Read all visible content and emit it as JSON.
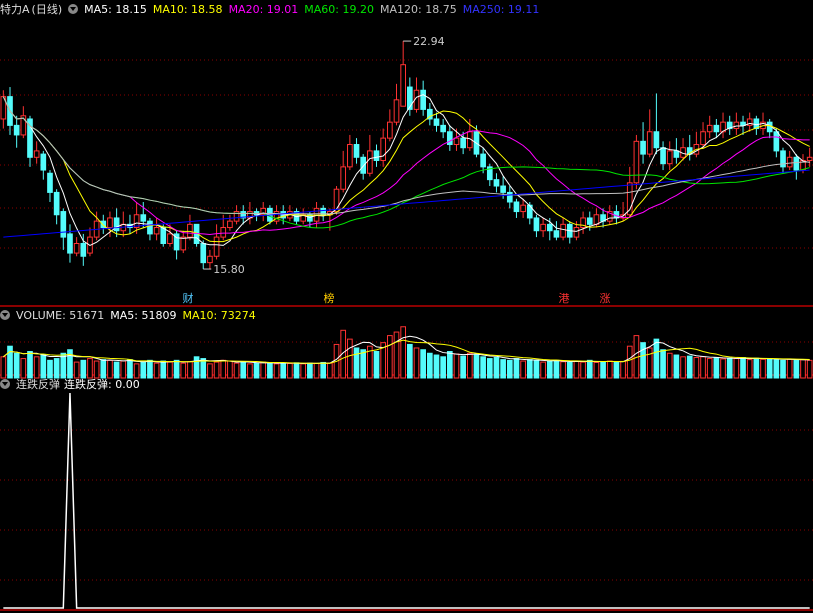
{
  "colors": {
    "up": "#ff3232",
    "down": "#54fcfc",
    "ma5": "#ffffff",
    "ma10": "#ffff00",
    "ma20": "#ff00ff",
    "ma60": "#00e600",
    "ma120": "#c0c0c0",
    "ma250": "#0000ff",
    "grid": "#8b0000"
  },
  "price_panel": {
    "stock_name": "特力A",
    "period": "(日线)",
    "ma_labels": [
      {
        "key": "ma5",
        "text": "MA5: 18.15"
      },
      {
        "key": "ma10",
        "text": "MA10: 18.58"
      },
      {
        "key": "ma20",
        "text": "MA20: 19.01"
      },
      {
        "key": "ma60",
        "text": "MA60: 19.20"
      },
      {
        "key": "ma120",
        "text": "MA120: 18.75"
      },
      {
        "key": "ma250",
        "text": "MA250: 19.11"
      }
    ],
    "high_label": "22.94",
    "low_label": "15.80",
    "event_tags": [
      {
        "text": "财",
        "index": 29
      },
      {
        "text": "榜",
        "index": 51
      },
      {
        "text": "港",
        "index": 89
      },
      {
        "text": "涨",
        "index": 96
      }
    ]
  },
  "volume_panel": {
    "title": "VOLUME: 51671",
    "ma5_label": "MA5: 51809",
    "ma10_label": "MA10: 73274"
  },
  "indicator_panel": {
    "title": "连跌反弹",
    "value_label": "连跌反弹: 0.00"
  },
  "chart_data": {
    "type": "candlestick",
    "ylim": [
      15.3,
      23.6
    ],
    "candles": [
      [
        20.5,
        21.2,
        20.2,
        21.4
      ],
      [
        21.2,
        20.3,
        20.0,
        21.5
      ],
      [
        20.3,
        20.0,
        19.6,
        20.6
      ],
      [
        20.0,
        20.6,
        19.9,
        20.9
      ],
      [
        20.5,
        19.3,
        19.0,
        20.6
      ],
      [
        19.3,
        19.5,
        19.1,
        19.8
      ],
      [
        19.4,
        18.9,
        18.6,
        19.5
      ],
      [
        18.8,
        18.2,
        17.9,
        18.9
      ],
      [
        18.2,
        17.5,
        17.2,
        18.3
      ],
      [
        17.6,
        16.8,
        16.4,
        17.7
      ],
      [
        16.9,
        16.3,
        16.0,
        17.2
      ],
      [
        16.3,
        16.6,
        16.2,
        16.8
      ],
      [
        16.6,
        16.2,
        15.9,
        16.9
      ],
      [
        16.3,
        16.8,
        16.2,
        17.1
      ],
      [
        16.8,
        17.3,
        16.7,
        17.6
      ],
      [
        17.3,
        17.1,
        16.9,
        17.5
      ],
      [
        17.1,
        17.4,
        16.8,
        17.6
      ],
      [
        17.4,
        17.0,
        16.8,
        17.7
      ],
      [
        17.0,
        17.2,
        16.8,
        17.6
      ],
      [
        17.2,
        17.1,
        16.9,
        17.5
      ],
      [
        17.1,
        17.5,
        16.9,
        17.9
      ],
      [
        17.5,
        17.3,
        17.1,
        17.9
      ],
      [
        17.3,
        16.9,
        16.7,
        17.4
      ],
      [
        16.9,
        17.1,
        16.7,
        17.4
      ],
      [
        17.1,
        16.6,
        16.5,
        17.2
      ],
      [
        16.6,
        16.9,
        16.5,
        17.2
      ],
      [
        16.9,
        16.4,
        16.1,
        17.0
      ],
      [
        16.4,
        16.8,
        16.3,
        17.0
      ],
      [
        16.8,
        17.2,
        16.7,
        17.5
      ],
      [
        17.2,
        16.6,
        16.5,
        17.2
      ],
      [
        16.6,
        16.0,
        15.8,
        16.7
      ],
      [
        16.0,
        16.2,
        15.8,
        16.4
      ],
      [
        16.2,
        16.8,
        16.1,
        17.2
      ],
      [
        16.8,
        17.1,
        16.7,
        17.5
      ],
      [
        17.1,
        17.3,
        17.0,
        17.5
      ],
      [
        17.3,
        17.6,
        17.2,
        17.8
      ],
      [
        17.6,
        17.4,
        17.2,
        17.8
      ],
      [
        17.4,
        17.6,
        17.2,
        17.9
      ],
      [
        17.6,
        17.5,
        17.3,
        17.7
      ],
      [
        17.5,
        17.7,
        17.3,
        17.9
      ],
      [
        17.7,
        17.3,
        17.2,
        17.8
      ],
      [
        17.3,
        17.6,
        17.2,
        17.8
      ],
      [
        17.6,
        17.4,
        17.2,
        17.8
      ],
      [
        17.4,
        17.6,
        17.3,
        17.8
      ],
      [
        17.6,
        17.3,
        17.2,
        17.7
      ],
      [
        17.3,
        17.5,
        17.2,
        17.7
      ],
      [
        17.5,
        17.3,
        17.1,
        17.6
      ],
      [
        17.3,
        17.7,
        17.1,
        17.9
      ],
      [
        17.7,
        17.5,
        17.3,
        17.8
      ],
      [
        17.5,
        17.6,
        17.0,
        17.7
      ],
      [
        17.6,
        18.3,
        17.5,
        18.4
      ],
      [
        18.3,
        19.0,
        18.2,
        19.5
      ],
      [
        19.0,
        19.7,
        18.9,
        20.0
      ],
      [
        19.7,
        19.3,
        19.1,
        19.9
      ],
      [
        19.3,
        18.8,
        18.6,
        19.4
      ],
      [
        18.8,
        19.5,
        18.7,
        20.0
      ],
      [
        19.5,
        19.2,
        19.0,
        19.7
      ],
      [
        19.2,
        19.9,
        19.0,
        20.2
      ],
      [
        19.9,
        20.4,
        19.8,
        20.8
      ],
      [
        20.4,
        21.1,
        20.3,
        21.6
      ],
      [
        20.9,
        22.2,
        20.9,
        22.94
      ],
      [
        21.5,
        20.8,
        20.6,
        21.8
      ],
      [
        20.8,
        21.4,
        20.7,
        21.8
      ],
      [
        21.4,
        20.8,
        20.6,
        21.7
      ],
      [
        20.8,
        20.5,
        20.3,
        21.0
      ],
      [
        20.5,
        20.3,
        20.1,
        20.7
      ],
      [
        20.3,
        20.1,
        19.9,
        20.5
      ],
      [
        20.1,
        19.7,
        19.5,
        20.3
      ],
      [
        19.7,
        19.9,
        19.5,
        20.2
      ],
      [
        19.9,
        19.6,
        19.4,
        20.1
      ],
      [
        19.6,
        20.1,
        19.5,
        20.5
      ],
      [
        20.1,
        19.4,
        19.3,
        20.3
      ],
      [
        19.4,
        19.0,
        18.8,
        19.6
      ],
      [
        19.0,
        18.6,
        18.4,
        19.1
      ],
      [
        18.6,
        18.4,
        18.2,
        18.8
      ],
      [
        18.4,
        18.2,
        18.0,
        18.7
      ],
      [
        18.2,
        17.9,
        17.7,
        18.4
      ],
      [
        17.9,
        17.6,
        17.4,
        18.0
      ],
      [
        17.6,
        17.8,
        17.4,
        18.0
      ],
      [
        17.8,
        17.4,
        17.2,
        17.9
      ],
      [
        17.4,
        17.0,
        16.8,
        17.5
      ],
      [
        17.0,
        17.2,
        16.8,
        17.4
      ],
      [
        17.2,
        17.0,
        16.7,
        17.4
      ],
      [
        17.0,
        16.8,
        16.7,
        17.3
      ],
      [
        16.8,
        17.2,
        16.7,
        17.4
      ],
      [
        17.2,
        16.8,
        16.6,
        17.3
      ],
      [
        16.8,
        17.1,
        16.7,
        17.3
      ],
      [
        17.1,
        17.4,
        16.9,
        17.6
      ],
      [
        17.4,
        17.2,
        17.0,
        17.6
      ],
      [
        17.2,
        17.5,
        17.1,
        17.7
      ],
      [
        17.5,
        17.3,
        17.1,
        17.7
      ],
      [
        17.3,
        17.6,
        17.2,
        17.8
      ],
      [
        17.6,
        17.4,
        17.2,
        17.8
      ],
      [
        17.4,
        17.5,
        17.3,
        17.9
      ],
      [
        17.5,
        18.5,
        17.4,
        19.0
      ],
      [
        18.5,
        19.8,
        18.3,
        20.0
      ],
      [
        19.8,
        19.4,
        19.1,
        20.4
      ],
      [
        19.4,
        20.1,
        19.3,
        20.8
      ],
      [
        20.1,
        19.6,
        19.4,
        21.3
      ],
      [
        19.6,
        19.1,
        18.9,
        19.8
      ],
      [
        19.1,
        19.5,
        18.9,
        19.8
      ],
      [
        19.5,
        19.3,
        19.1,
        19.9
      ],
      [
        19.3,
        19.6,
        19.2,
        19.9
      ],
      [
        19.6,
        19.4,
        19.2,
        20.0
      ],
      [
        19.4,
        19.7,
        19.3,
        20.1
      ],
      [
        19.7,
        20.1,
        19.6,
        20.4
      ],
      [
        20.1,
        20.3,
        19.9,
        20.6
      ],
      [
        20.3,
        20.1,
        19.9,
        20.5
      ],
      [
        20.1,
        20.4,
        19.9,
        20.7
      ],
      [
        20.4,
        20.2,
        20.0,
        20.6
      ],
      [
        20.2,
        20.4,
        20.0,
        20.7
      ],
      [
        20.4,
        20.3,
        20.0,
        20.6
      ],
      [
        20.3,
        20.5,
        20.1,
        20.7
      ],
      [
        20.5,
        20.2,
        20.0,
        20.6
      ],
      [
        20.2,
        20.4,
        20.0,
        20.7
      ],
      [
        20.4,
        20.1,
        19.9,
        20.5
      ],
      [
        20.1,
        19.5,
        19.3,
        20.2
      ],
      [
        19.5,
        19.0,
        18.8,
        19.6
      ],
      [
        19.0,
        19.3,
        18.9,
        19.5
      ],
      [
        19.3,
        18.9,
        18.6,
        19.4
      ],
      [
        18.9,
        19.2,
        18.8,
        19.4
      ],
      [
        19.2,
        19.3,
        19.0,
        19.6
      ]
    ],
    "volume": {
      "ylim": [
        0,
        150000
      ],
      "values": [
        60000,
        90000,
        70000,
        55000,
        75000,
        60000,
        65000,
        50000,
        55000,
        70000,
        80000,
        45000,
        50000,
        55000,
        48000,
        52000,
        50000,
        45000,
        48000,
        52000,
        40000,
        45000,
        50000,
        42000,
        48000,
        45000,
        50000,
        42000,
        46000,
        60000,
        55000,
        40000,
        45000,
        50000,
        48000,
        42000,
        45000,
        40000,
        42000,
        45000,
        43000,
        40000,
        42000,
        41000,
        43000,
        40000,
        42000,
        41000,
        44000,
        42000,
        95000,
        135000,
        110000,
        85000,
        80000,
        90000,
        75000,
        100000,
        120000,
        130000,
        145000,
        95000,
        85000,
        80000,
        70000,
        65000,
        60000,
        75000,
        68000,
        62000,
        70000,
        65000,
        60000,
        55000,
        58000,
        52000,
        50000,
        55000,
        48000,
        52000,
        50000,
        45000,
        48000,
        50000,
        46000,
        44000,
        48000,
        45000,
        50000,
        44000,
        46000,
        48000,
        45000,
        47000,
        90000,
        120000,
        100000,
        85000,
        110000,
        80000,
        70000,
        65000,
        60000,
        62000,
        58000,
        60000,
        55000,
        57000,
        54000,
        56000,
        55000,
        58000,
        52000,
        56000,
        53000,
        55000,
        52000,
        50000,
        53000,
        51000,
        51671,
        50000
      ]
    },
    "indicator": {
      "ylim": [
        0,
        1
      ],
      "spike_index": 10,
      "value": 0.0
    }
  }
}
